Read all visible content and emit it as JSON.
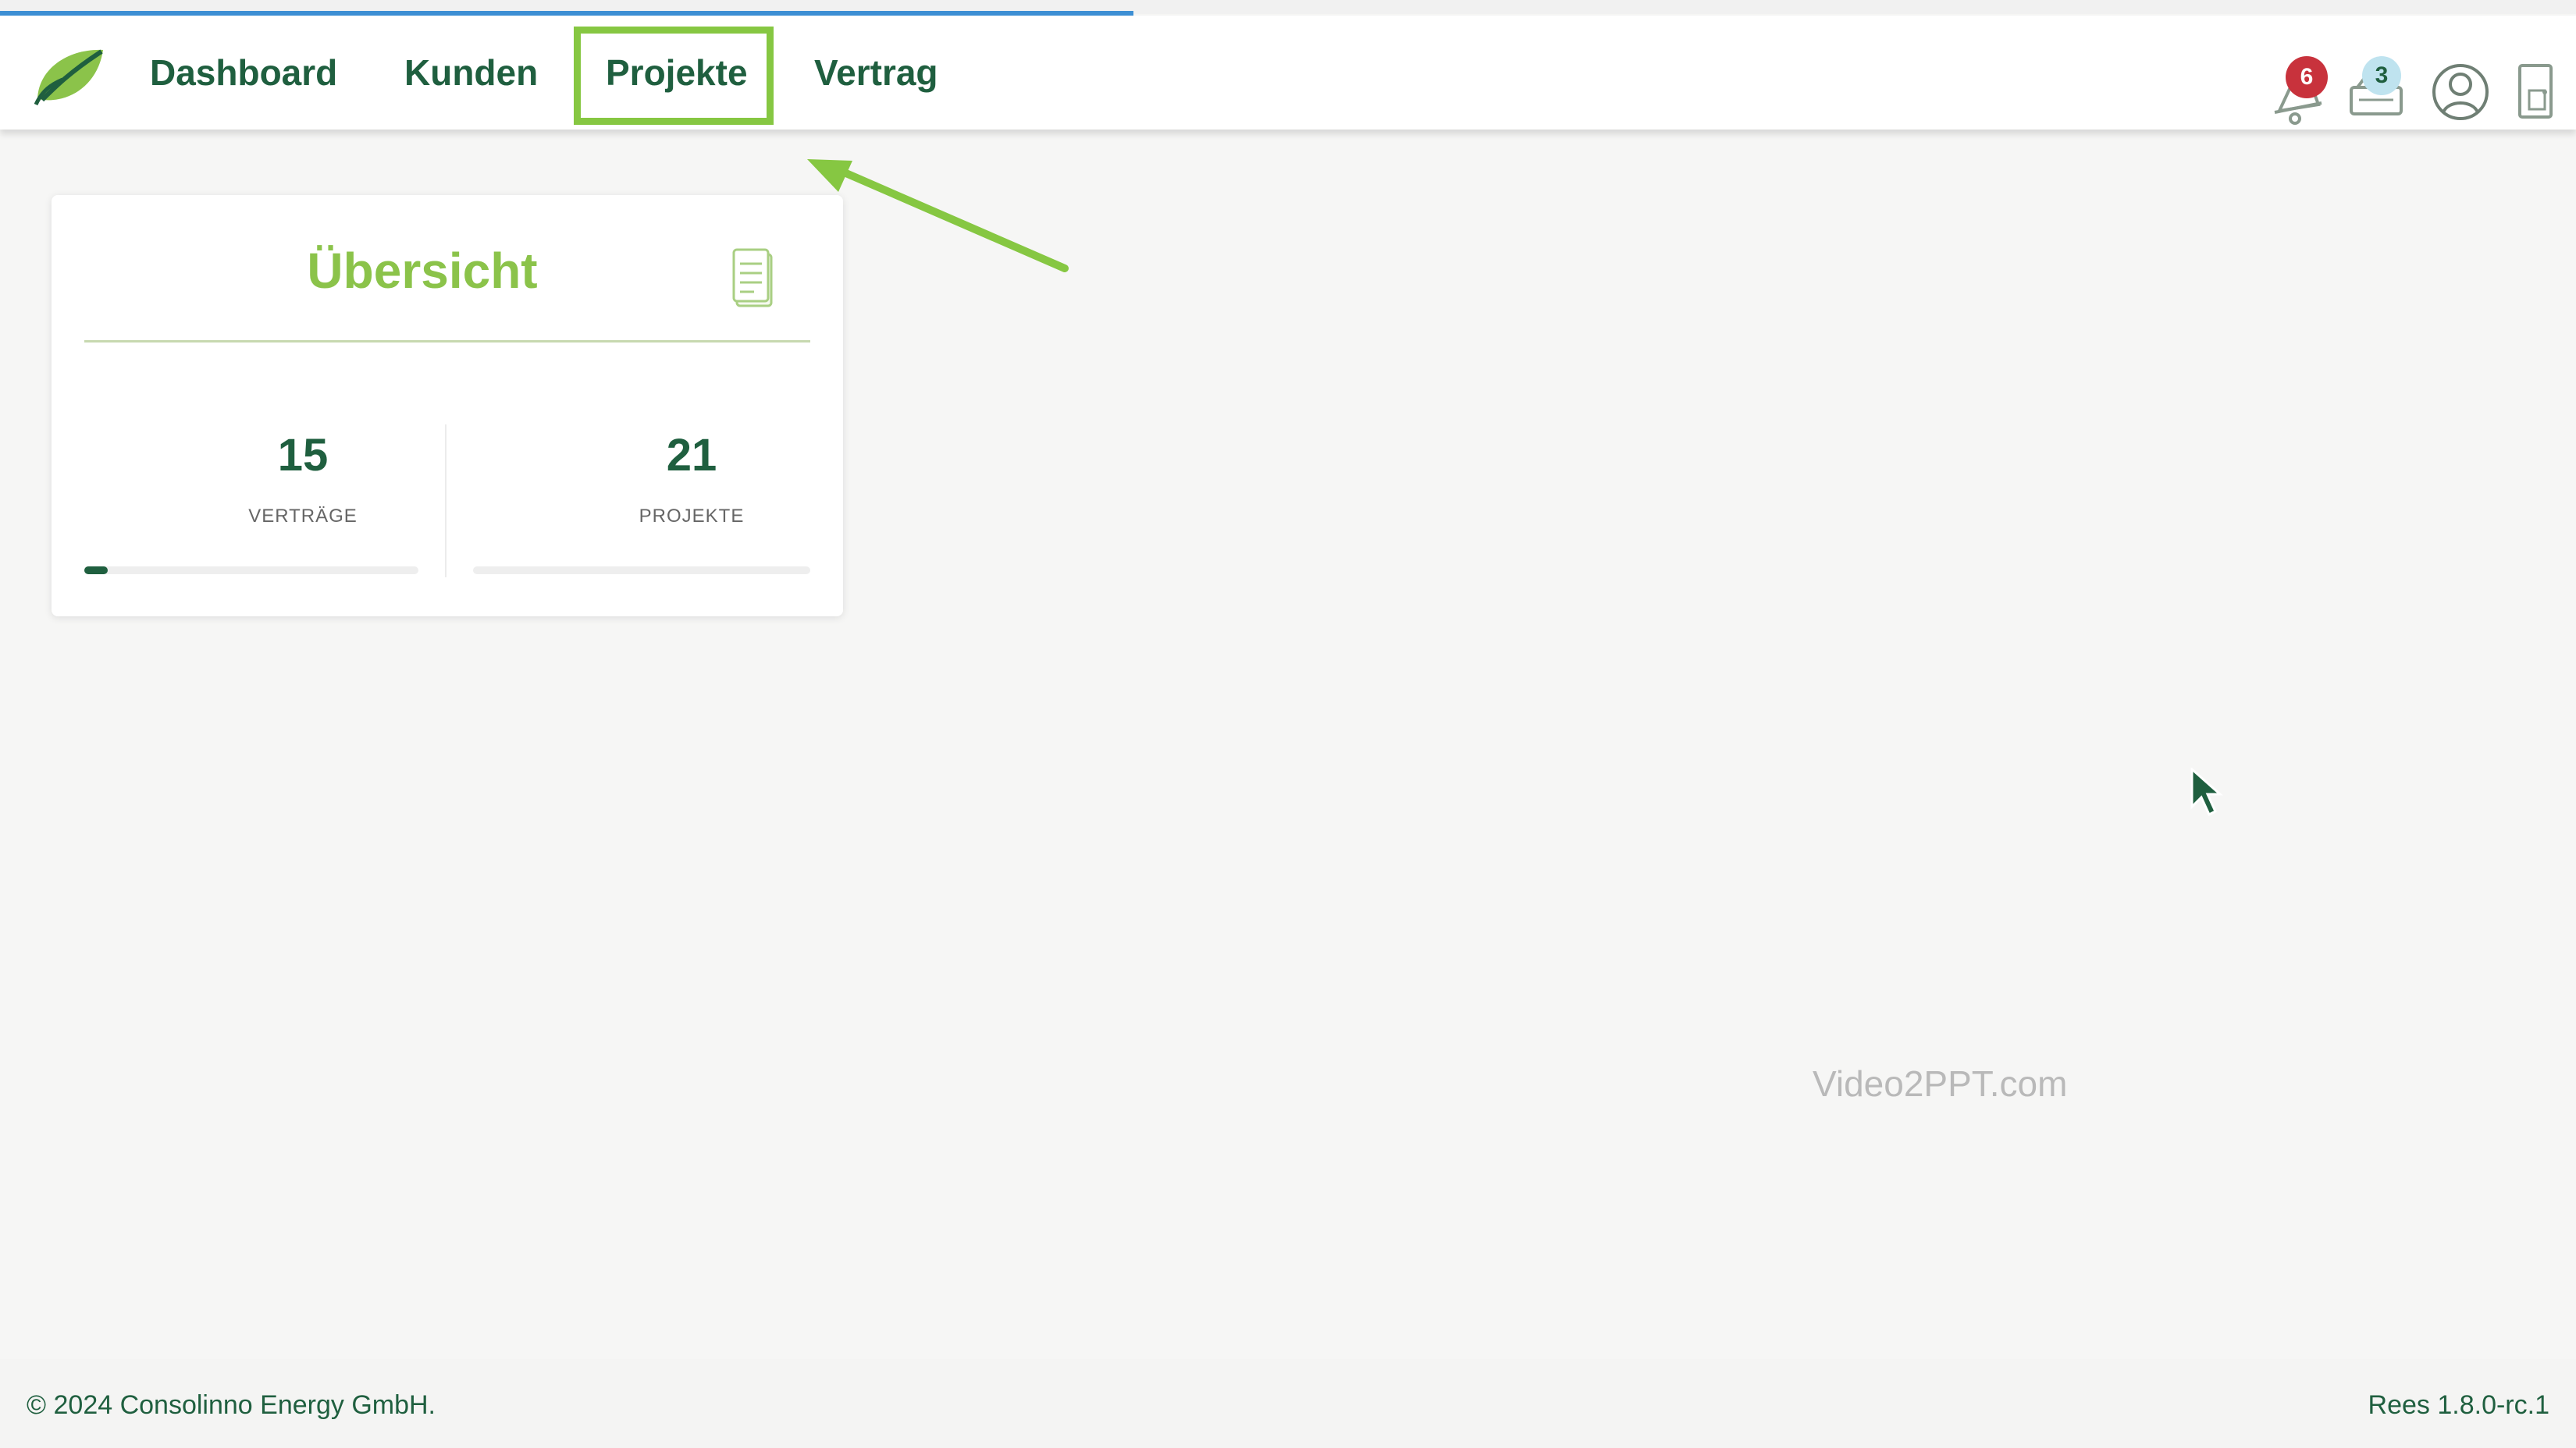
{
  "nav": {
    "items": [
      {
        "label": "Dashboard"
      },
      {
        "label": "Kunden"
      },
      {
        "label": "Projekte"
      },
      {
        "label": "Vertrag"
      }
    ],
    "highlighted": "Projekte"
  },
  "header": {
    "notifications_count": "6",
    "tickets_count": "3",
    "icons": [
      "bell-icon",
      "tickets-icon",
      "user-icon",
      "logout-door-icon"
    ]
  },
  "top_loading_progress": 0.44,
  "card": {
    "title": "Übersicht",
    "stats": [
      {
        "value": "15",
        "label": "VERTRÄGE",
        "progress": 0.07
      },
      {
        "value": "21",
        "label": "PROJEKTE",
        "progress": 0
      }
    ]
  },
  "watermark": "Video2PPT.com",
  "footer": {
    "copyright": "© 2024 Consolinno Energy GmbH.",
    "version": "Rees 1.8.0-rc.1"
  },
  "colors": {
    "brand_dark": "#1f5f3f",
    "brand_light": "#8bc34a",
    "highlight": "#86c742",
    "badge_red": "#c8323c",
    "badge_blue": "#bfe3ef"
  }
}
